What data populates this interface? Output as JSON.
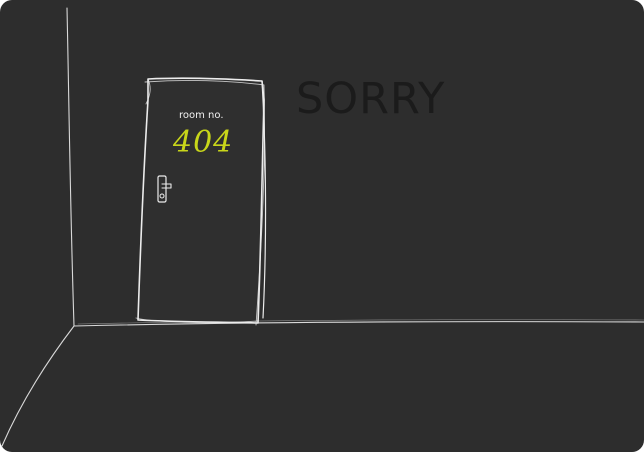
{
  "page": {
    "title": "SORRY",
    "door": {
      "room_label": "room no.",
      "room_number": "404"
    }
  },
  "colors": {
    "background": "#2d2d2d",
    "outline": "#e6e6e6",
    "title": "#1b1b1b",
    "room_number": "#c8d61a"
  },
  "icons": {
    "door": "door-icon",
    "handle": "door-handle-icon"
  }
}
